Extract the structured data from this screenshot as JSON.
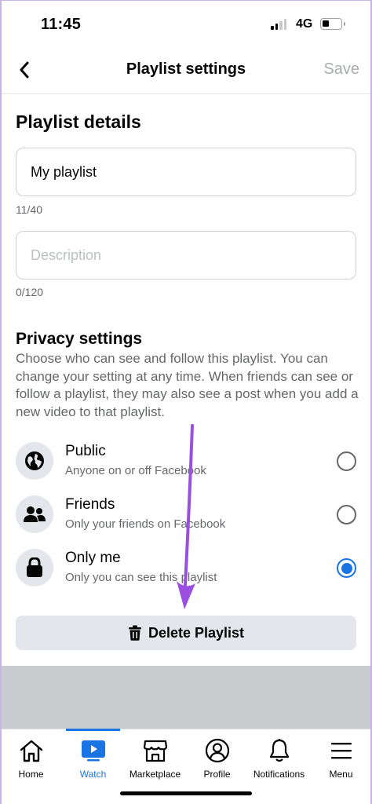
{
  "status_bar": {
    "time": "11:45",
    "network": "4G"
  },
  "header": {
    "title": "Playlist settings",
    "save_label": "Save"
  },
  "details": {
    "title": "Playlist details",
    "name_value": "My playlist",
    "name_counter": "11/40",
    "description_placeholder": "Description",
    "description_counter": "0/120"
  },
  "privacy": {
    "title": "Privacy settings",
    "description": "Choose who can see and follow this playlist. You can change your setting at any time. When friends can see or follow a playlist, they may also see a post when you add a new video to that playlist.",
    "options": [
      {
        "title": "Public",
        "subtitle": "Anyone on or off Facebook",
        "icon": "globe-icon",
        "selected": false
      },
      {
        "title": "Friends",
        "subtitle": "Only your friends on Facebook",
        "icon": "friends-icon",
        "selected": false
      },
      {
        "title": "Only me",
        "subtitle": "Only you can see this playlist",
        "icon": "lock-icon",
        "selected": true
      }
    ]
  },
  "delete_label": "Delete Playlist",
  "tab_bar": {
    "items": [
      {
        "label": "Home",
        "icon": "home-icon",
        "active": false
      },
      {
        "label": "Watch",
        "icon": "watch-icon",
        "active": true
      },
      {
        "label": "Marketplace",
        "icon": "marketplace-icon",
        "active": false
      },
      {
        "label": "Profile",
        "icon": "profile-icon",
        "active": false
      },
      {
        "label": "Notifications",
        "icon": "bell-icon",
        "active": false
      },
      {
        "label": "Menu",
        "icon": "menu-icon",
        "active": false
      }
    ]
  },
  "colors": {
    "accent": "#1b74e4",
    "annotation_arrow": "#9b4fe0"
  }
}
